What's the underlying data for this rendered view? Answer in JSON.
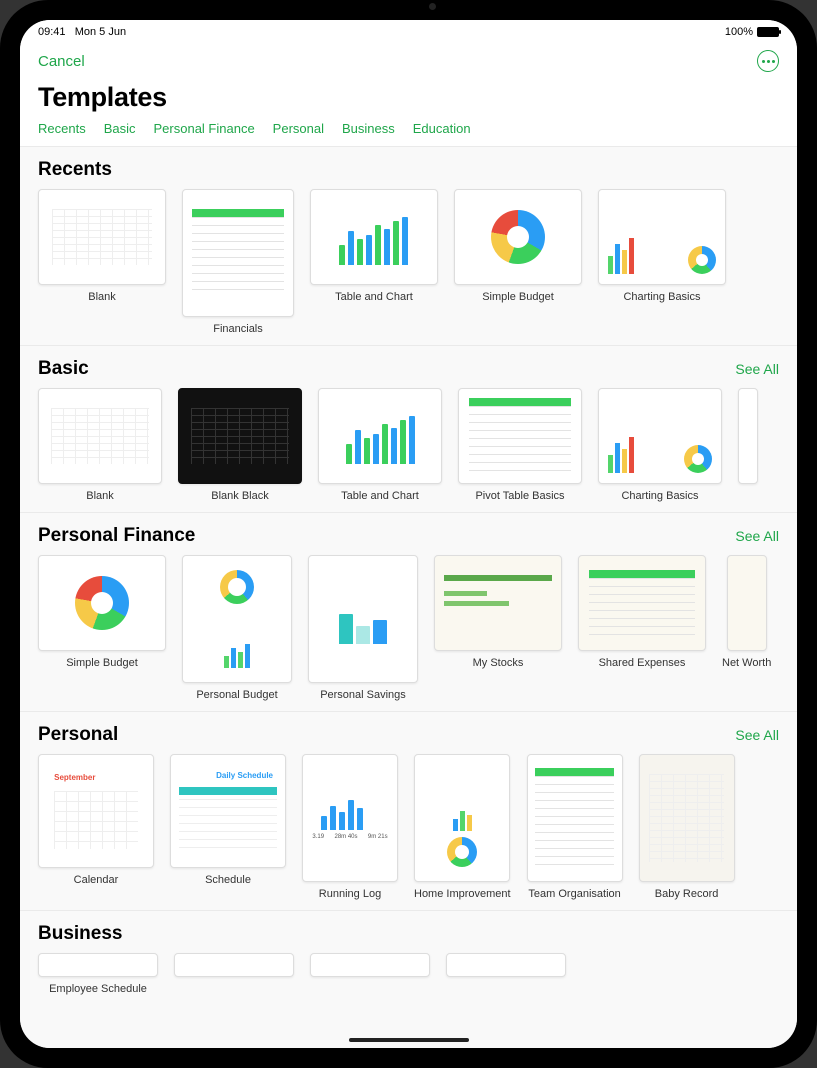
{
  "status": {
    "time": "09:41",
    "date": "Mon 5 Jun",
    "battery": "100%"
  },
  "header": {
    "cancel": "Cancel",
    "title": "Templates"
  },
  "tabs": [
    "Recents",
    "Basic",
    "Personal Finance",
    "Personal",
    "Business",
    "Education"
  ],
  "see_all": "See All",
  "sections": {
    "recents": {
      "title": "Recents",
      "items": [
        {
          "label": "Blank"
        },
        {
          "label": "Financials"
        },
        {
          "label": "Table and Chart"
        },
        {
          "label": "Simple Budget"
        },
        {
          "label": "Charting Basics"
        }
      ]
    },
    "basic": {
      "title": "Basic",
      "items": [
        {
          "label": "Blank"
        },
        {
          "label": "Blank Black"
        },
        {
          "label": "Table and Chart"
        },
        {
          "label": "Pivot Table Basics"
        },
        {
          "label": "Charting Basics"
        }
      ]
    },
    "personal_finance": {
      "title": "Personal Finance",
      "items": [
        {
          "label": "Simple Budget"
        },
        {
          "label": "Personal Budget"
        },
        {
          "label": "Personal Savings"
        },
        {
          "label": "My Stocks"
        },
        {
          "label": "Shared Expenses"
        },
        {
          "label": "Net Worth"
        }
      ]
    },
    "personal": {
      "title": "Personal",
      "items": [
        {
          "label": "Calendar"
        },
        {
          "label": "Schedule"
        },
        {
          "label": "Running Log"
        },
        {
          "label": "Home Improvement"
        },
        {
          "label": "Team Organisation"
        },
        {
          "label": "Baby Record"
        }
      ]
    },
    "business": {
      "title": "Business",
      "items": [
        {
          "label": "Employee Schedule"
        },
        {
          "label": ""
        },
        {
          "label": ""
        },
        {
          "label": ""
        }
      ]
    }
  }
}
